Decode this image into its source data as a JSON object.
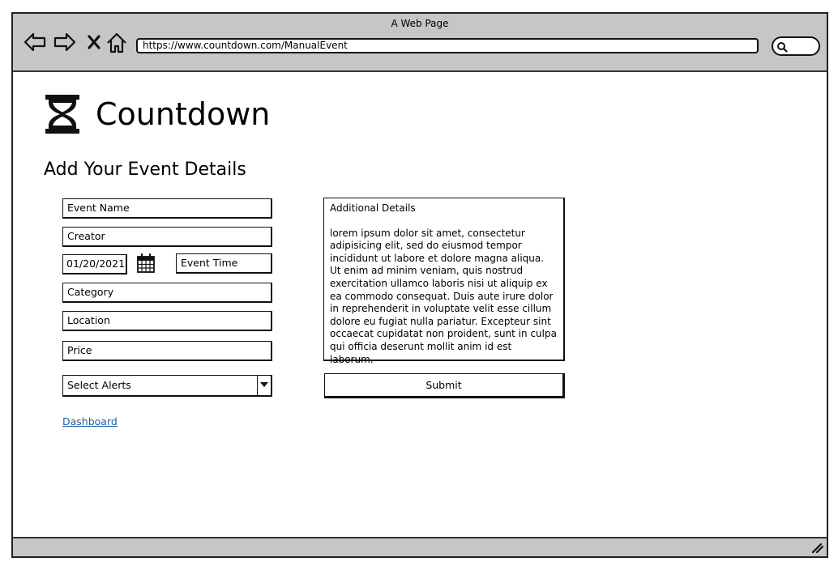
{
  "browser": {
    "window_title": "A Web Page",
    "url": "https://www.countdown.com/ManualEvent"
  },
  "page": {
    "brand": "Countdown",
    "heading": "Add Your Event Details"
  },
  "form": {
    "event_name": "Event Name",
    "creator": "Creator",
    "date": "01/20/2021",
    "event_time": "Event Time",
    "category": "Category",
    "location": "Location",
    "price": "Price",
    "alerts_select": "Select Alerts",
    "additional_label": "Additional Details",
    "additional_text": "lorem ipsum dolor sit amet, consectetur adipisicing elit, sed do eiusmod tempor incididunt ut labore et dolore magna aliqua. Ut enim ad minim veniam, quis nostrud exercitation ullamco laboris nisi ut aliquip ex ea commodo consequat. Duis aute irure dolor in reprehenderit in voluptate velit esse cillum dolore eu fugiat nulla pariatur. Excepteur sint occaecat cupidatat non proident, sunt in culpa qui officia deserunt mollit anim id est laborum.",
    "submit_label": "Submit"
  },
  "links": {
    "dashboard": "Dashboard"
  },
  "icons": {
    "back": "back-arrow-icon",
    "forward": "forward-arrow-icon",
    "stop": "close-icon",
    "home": "home-icon",
    "search": "search-icon",
    "logo": "hourglass-icon",
    "calendar": "calendar-icon",
    "dropdown": "chevron-down-icon",
    "resize": "resize-grip-icon"
  }
}
